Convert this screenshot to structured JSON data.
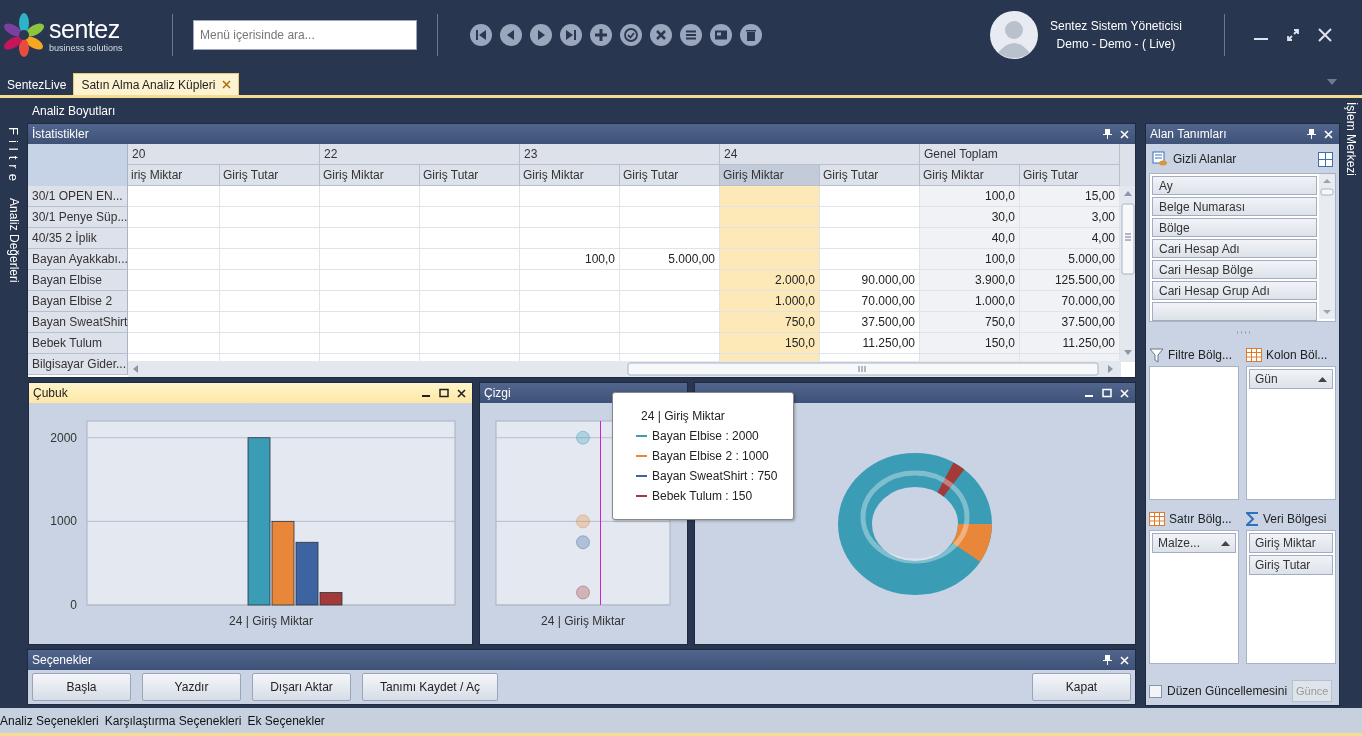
{
  "app": {
    "logo_name": "sentez",
    "logo_tagline": "business solutions"
  },
  "search": {
    "placeholder": "Menü içerisinde ara..."
  },
  "user": {
    "name": "Sentez Sistem Yöneticisi",
    "context": "Demo - Demo - ( Live)"
  },
  "tabs": [
    {
      "label": "SentezLive",
      "selected": false,
      "closable": false
    },
    {
      "label": "Satın Alma Analiz Küpleri",
      "selected": true,
      "closable": true
    }
  ],
  "top_label": "Analiz Boyutları",
  "left_strip": [
    "Filtre",
    "Analiz Değerleri"
  ],
  "right_strip": "İşlem Merkezi",
  "stats": {
    "title": "İstatistikler",
    "groups": [
      {
        "label": "20",
        "kind": "day",
        "measures": [
          {
            "label": "iriş Miktar",
            "selected": false
          },
          {
            "label": "Giriş Tutar",
            "selected": false
          }
        ]
      },
      {
        "label": "22",
        "kind": "day",
        "measures": [
          {
            "label": "Giriş Miktar",
            "selected": false
          },
          {
            "label": "Giriş Tutar",
            "selected": false
          }
        ]
      },
      {
        "label": "23",
        "kind": "day",
        "measures": [
          {
            "label": "Giriş Miktar",
            "selected": false
          },
          {
            "label": "Giriş Tutar",
            "selected": false
          }
        ]
      },
      {
        "label": "24",
        "kind": "day",
        "measures": [
          {
            "label": "Giriş Miktar",
            "selected": true
          },
          {
            "label": "Giriş Tutar",
            "selected": false
          }
        ]
      },
      {
        "label": "Genel Toplam",
        "kind": "total",
        "measures": [
          {
            "label": "Giriş Miktar",
            "selected": false
          },
          {
            "label": "Giriş Tutar",
            "selected": false
          }
        ]
      }
    ],
    "rows": [
      {
        "label": "30/1 OPEN EN...",
        "cells": [
          null,
          null,
          null,
          null,
          null,
          null,
          null,
          null,
          "100,0",
          "15,00"
        ]
      },
      {
        "label": "30/1 Penye Süp...",
        "cells": [
          null,
          null,
          null,
          null,
          null,
          null,
          null,
          null,
          "30,0",
          "3,00"
        ]
      },
      {
        "label": "40/35 2 İplik",
        "cells": [
          null,
          null,
          null,
          null,
          null,
          null,
          null,
          null,
          "40,0",
          "4,00"
        ]
      },
      {
        "label": "Bayan Ayakkabı...",
        "cells": [
          null,
          null,
          null,
          null,
          "100,0",
          "5.000,00",
          null,
          null,
          "100,0",
          "5.000,00"
        ]
      },
      {
        "label": "Bayan Elbise",
        "cells": [
          null,
          null,
          null,
          null,
          null,
          null,
          "2.000,0",
          "90.000,00",
          "3.900,0",
          "125.500,00"
        ]
      },
      {
        "label": "Bayan Elbise 2",
        "cells": [
          null,
          null,
          null,
          null,
          null,
          null,
          "1.000,0",
          "70.000,00",
          "1.000,0",
          "70.000,00"
        ]
      },
      {
        "label": "Bayan SweatShirt",
        "cells": [
          null,
          null,
          null,
          null,
          null,
          null,
          "750,0",
          "37.500,00",
          "750,0",
          "37.500,00"
        ]
      },
      {
        "label": "Bebek Tulum",
        "cells": [
          null,
          null,
          null,
          null,
          null,
          null,
          "150,0",
          "11.250,00",
          "150,0",
          "11.250,00"
        ]
      },
      {
        "label": "Bilgisayar Gider...",
        "cells": [
          null,
          null,
          null,
          null,
          null,
          null,
          null,
          null,
          null,
          null
        ]
      }
    ]
  },
  "bar_panel": {
    "title": "Çubuk",
    "active": true,
    "chart_data": {
      "type": "bar",
      "categories": [
        "24 | Giriş Miktar"
      ],
      "ylim": [
        0,
        2200
      ],
      "yticks": [
        0,
        1000,
        2000
      ],
      "series": [
        {
          "color": "#3a9cb5",
          "values": [
            2000
          ]
        },
        {
          "color": "#e8873a",
          "values": [
            1000
          ]
        },
        {
          "color": "#3d63a0",
          "values": [
            750
          ]
        },
        {
          "color": "#a33a3a",
          "values": [
            150
          ]
        }
      ]
    }
  },
  "line_panel": {
    "title": "Çizgi",
    "active": false,
    "chart_data": {
      "type": "scatter",
      "categories": [
        "24 | Giriş Miktar"
      ],
      "ylim": [
        0,
        2200
      ],
      "series": [
        {
          "color": "#3a9cb5",
          "values": [
            2000
          ]
        },
        {
          "color": "#e8873a",
          "values": [
            1000
          ]
        },
        {
          "color": "#3d63a0",
          "values": [
            750
          ]
        },
        {
          "color": "#a33a3a",
          "values": [
            150
          ]
        }
      ]
    }
  },
  "donut_panel": {
    "active": false
  },
  "tooltip": {
    "title": "24 | Giriş Miktar",
    "items": [
      {
        "label": "Bayan Elbise : 2000",
        "color": "#3a9cb5"
      },
      {
        "label": "Bayan Elbise 2 : 1000",
        "color": "#e8873a"
      },
      {
        "label": "Bayan SweatShirt : 750",
        "color": "#3d63a0"
      },
      {
        "label": "Bebek Tulum : 150",
        "color": "#a33a3a"
      }
    ]
  },
  "options": {
    "title": "Seçenekler",
    "buttons": [
      "Başla",
      "Yazdır",
      "Dışarı Aktar",
      "Tanımı Kaydet / Aç"
    ],
    "close_button": "Kapat"
  },
  "fields": {
    "title": "Alan Tanımları",
    "hidden_title": "Gizli Alanlar",
    "hidden_fields": [
      "Ay",
      "Belge Numarası",
      "Bölge",
      "Cari Hesap Adı",
      "Cari Hesap Bölge",
      "Cari Hesap Grup Adı"
    ],
    "areas": [
      {
        "title": "Filtre Bölg...",
        "kind": "filter"
      },
      {
        "title": "Kolon Böl...",
        "kind": "column",
        "items": [
          {
            "label": "Gün",
            "sorted": true
          }
        ]
      },
      {
        "title": "Satır Bölg...",
        "kind": "row",
        "items": [
          {
            "label": "Malze...",
            "sorted": true
          }
        ]
      },
      {
        "title": "Veri Bölgesi",
        "kind": "data",
        "items": [
          {
            "label": "Giriş Miktar",
            "sorted": false
          },
          {
            "label": "Giriş Tutar",
            "sorted": false
          }
        ]
      }
    ],
    "defer": {
      "label": "Düzen Güncellemesini",
      "checked": false
    },
    "update_button": {
      "label": "Günce",
      "disabled": true
    }
  },
  "bottom_tabs": [
    "Analiz Seçenekleri",
    "Karşılaştırma Seçenekleri",
    "Ek Seçenekler"
  ]
}
